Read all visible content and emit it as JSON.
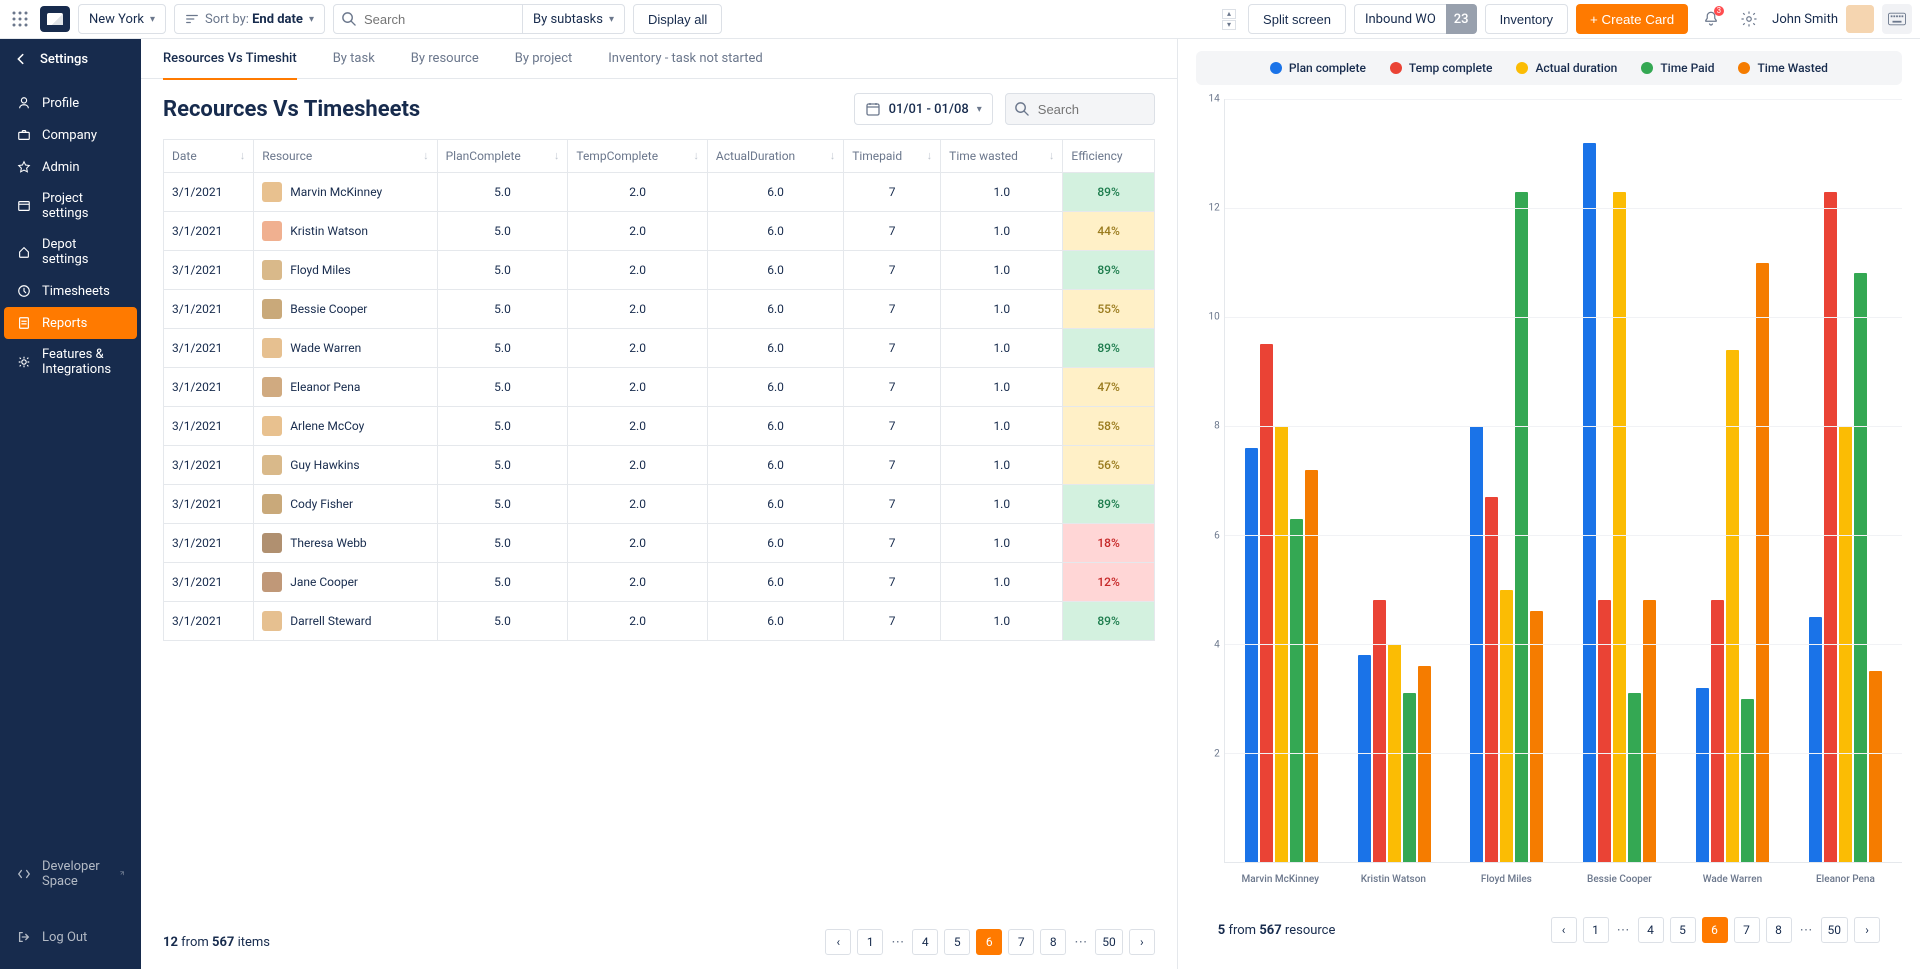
{
  "topbar": {
    "location": "New York",
    "sort_prefix": "Sort by: ",
    "sort_value": "End date",
    "search_placeholder": "Search",
    "subtasks": "By subtasks",
    "display_all": "Display all",
    "split_screen": "Split screen",
    "inbound_wo": "Inbound WO",
    "inbound_count": "23",
    "inventory": "Inventory",
    "create_card": "+ Create Card",
    "notif_count": "3",
    "user_name": "John Smith"
  },
  "sidebar": {
    "title": "Settings",
    "items": [
      {
        "label": "Profile",
        "icon": "user"
      },
      {
        "label": "Company",
        "icon": "briefcase"
      },
      {
        "label": "Admin",
        "icon": "star"
      },
      {
        "label": "Project settings",
        "icon": "layout"
      },
      {
        "label": "Depot settings",
        "icon": "home"
      },
      {
        "label": "Timesheets",
        "icon": "clock"
      },
      {
        "label": "Reports",
        "icon": "file",
        "active": true
      },
      {
        "label": "Features & Integrations",
        "icon": "gear"
      }
    ],
    "dev_space": "Developer Space",
    "logout": "Log Out"
  },
  "tabs": [
    {
      "label": "Resources Vs Timeshit",
      "active": true
    },
    {
      "label": "By task"
    },
    {
      "label": "By resource"
    },
    {
      "label": "By project"
    },
    {
      "label": "Inventory - task not started"
    }
  ],
  "page_title": "Recources Vs Timesheets",
  "date_range": "01/01 - 01/08",
  "table_search_placeholder": "Search",
  "columns": [
    "Date",
    "Resource",
    "PlanComplete",
    "TempComplete",
    "ActualDuration",
    "Timepaid",
    "Time wasted",
    "Efficiency"
  ],
  "rows": [
    {
      "date": "3/1/2021",
      "name": "Marvin McKinney",
      "pc": "5.0",
      "tc": "2.0",
      "ad": "6.0",
      "tp": "7",
      "tw": "1.0",
      "eff": "89%",
      "effc": "green",
      "av": "#E8C18F"
    },
    {
      "date": "3/1/2021",
      "name": "Kristin Watson",
      "pc": "5.0",
      "tc": "2.0",
      "ad": "6.0",
      "tp": "7",
      "tw": "1.0",
      "eff": "44%",
      "effc": "yellow",
      "av": "#F0B090"
    },
    {
      "date": "3/1/2021",
      "name": "Floyd Miles",
      "pc": "5.0",
      "tc": "2.0",
      "ad": "6.0",
      "tp": "7",
      "tw": "1.0",
      "eff": "89%",
      "effc": "green",
      "av": "#D9B98A"
    },
    {
      "date": "3/1/2021",
      "name": "Bessie Cooper",
      "pc": "5.0",
      "tc": "2.0",
      "ad": "6.0",
      "tp": "7",
      "tw": "1.0",
      "eff": "55%",
      "effc": "yellow",
      "av": "#C9A97A"
    },
    {
      "date": "3/1/2021",
      "name": "Wade Warren",
      "pc": "5.0",
      "tc": "2.0",
      "ad": "6.0",
      "tp": "7",
      "tw": "1.0",
      "eff": "89%",
      "effc": "green",
      "av": "#E6C090"
    },
    {
      "date": "3/1/2021",
      "name": "Eleanor Pena",
      "pc": "5.0",
      "tc": "2.0",
      "ad": "6.0",
      "tp": "7",
      "tw": "1.0",
      "eff": "47%",
      "effc": "yellow",
      "av": "#D0AA80"
    },
    {
      "date": "3/1/2021",
      "name": "Arlene McCoy",
      "pc": "5.0",
      "tc": "2.0",
      "ad": "6.0",
      "tp": "7",
      "tw": "1.0",
      "eff": "58%",
      "effc": "yellow",
      "av": "#E8C18F"
    },
    {
      "date": "3/1/2021",
      "name": "Guy Hawkins",
      "pc": "5.0",
      "tc": "2.0",
      "ad": "6.0",
      "tp": "7",
      "tw": "1.0",
      "eff": "56%",
      "effc": "yellow",
      "av": "#D9B98A"
    },
    {
      "date": "3/1/2021",
      "name": "Cody Fisher",
      "pc": "5.0",
      "tc": "2.0",
      "ad": "6.0",
      "tp": "7",
      "tw": "1.0",
      "eff": "89%",
      "effc": "green",
      "av": "#C9A97A"
    },
    {
      "date": "3/1/2021",
      "name": "Theresa Webb",
      "pc": "5.0",
      "tc": "2.0",
      "ad": "6.0",
      "tp": "7",
      "tw": "1.0",
      "eff": "18%",
      "effc": "red",
      "av": "#B09070"
    },
    {
      "date": "3/1/2021",
      "name": "Jane Cooper",
      "pc": "5.0",
      "tc": "2.0",
      "ad": "6.0",
      "tp": "7",
      "tw": "1.0",
      "eff": "12%",
      "effc": "red",
      "av": "#C09878"
    },
    {
      "date": "3/1/2021",
      "name": "Darrell Steward",
      "pc": "5.0",
      "tc": "2.0",
      "ad": "6.0",
      "tp": "7",
      "tw": "1.0",
      "eff": "89%",
      "effc": "green",
      "av": "#E6C090"
    }
  ],
  "left_footer": {
    "count": "12",
    "total": "567",
    "from_text": " from ",
    "items_text": " items"
  },
  "left_pages": [
    "1",
    "…",
    "4",
    "5",
    "6",
    "7",
    "8",
    "…",
    "50"
  ],
  "left_active_page": "6",
  "legend": [
    {
      "label": "Plan complete",
      "color": "#1A73E8"
    },
    {
      "label": "Temp complete",
      "color": "#EA4335"
    },
    {
      "label": "Actual duration",
      "color": "#FBBC04"
    },
    {
      "label": "Time Paid",
      "color": "#34A853"
    },
    {
      "label": "Time Wasted",
      "color": "#F57C00"
    }
  ],
  "chart_data": {
    "type": "bar",
    "ylim": [
      0,
      14
    ],
    "yticks": [
      2,
      4,
      6,
      8,
      10,
      12,
      14
    ],
    "categories": [
      "Marvin McKinney",
      "Kristin Watson",
      "Floyd Miles",
      "Bessie Cooper",
      "Wade Warren",
      "Eleanor Pena"
    ],
    "series": [
      {
        "name": "Plan complete",
        "color": "#1A73E8",
        "values": [
          7.6,
          3.8,
          8.0,
          13.2,
          3.2,
          4.5
        ]
      },
      {
        "name": "Temp complete",
        "color": "#EA4335",
        "values": [
          9.5,
          4.8,
          6.7,
          4.8,
          4.8,
          12.3
        ]
      },
      {
        "name": "Actual duration",
        "color": "#FBBC04",
        "values": [
          8.0,
          4.0,
          5.0,
          12.3,
          9.4,
          8.0
        ]
      },
      {
        "name": "Time Paid",
        "color": "#34A853",
        "values": [
          6.3,
          3.1,
          12.3,
          3.1,
          3.0,
          10.8
        ]
      },
      {
        "name": "Time Wasted",
        "color": "#F57C00",
        "values": [
          7.2,
          3.6,
          4.6,
          4.8,
          11.0,
          3.5
        ]
      }
    ]
  },
  "right_footer": {
    "count": "5",
    "total": "567",
    "from_text": " from ",
    "res_text": " resource"
  },
  "right_pages": [
    "1",
    "…",
    "4",
    "5",
    "6",
    "7",
    "8",
    "…",
    "50"
  ],
  "right_active_page": "6"
}
